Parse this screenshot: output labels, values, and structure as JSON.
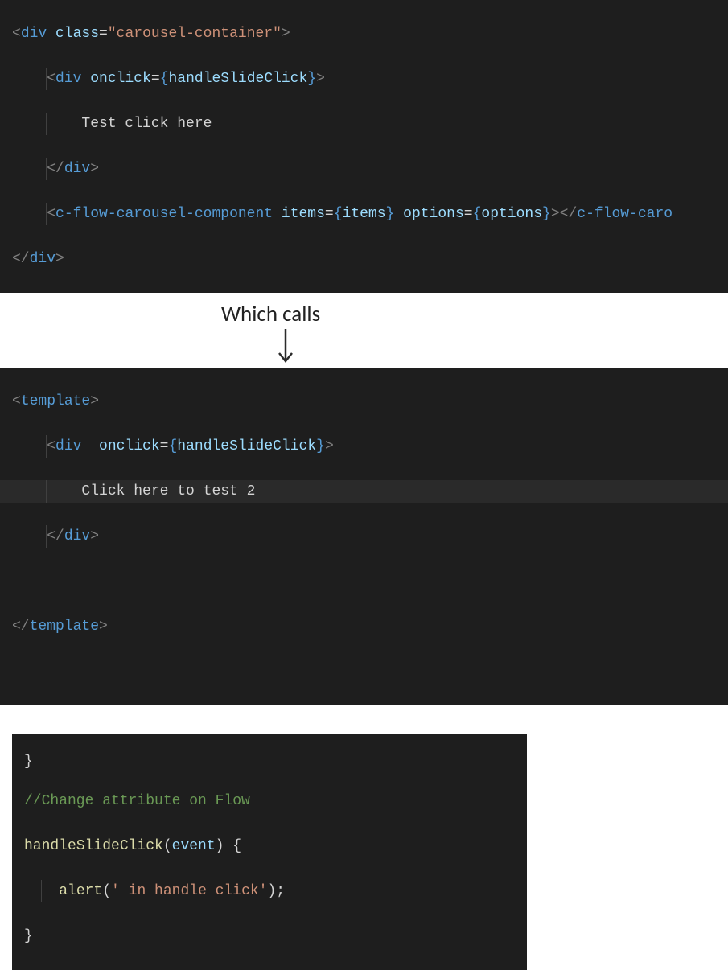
{
  "annotation": {
    "label": "Which calls"
  },
  "code1": {
    "l1": {
      "tag": "div",
      "attr": "class",
      "val": "\"carousel-container\""
    },
    "l2": {
      "tag": "div",
      "attr": "onclick",
      "expr": "handleSlideClick"
    },
    "l3": {
      "text": "Test click here"
    },
    "l4": {
      "tag": "div"
    },
    "l5": {
      "tag": "c-flow-carousel-component",
      "a1": "items",
      "v1": "items",
      "a2": "options",
      "v2": "options",
      "closeTag": "c-flow-caro"
    },
    "l6": {
      "tag": "div"
    }
  },
  "code2": {
    "l1": {
      "tag": "template"
    },
    "l2": {
      "tag": "div",
      "attr": "onclick",
      "expr": "handleSlideClick"
    },
    "l3": {
      "text": "Click here to test 2"
    },
    "l4": {
      "tag": "div"
    },
    "l5": {
      "tag": "template"
    }
  },
  "code3": {
    "l1": {
      "text": "}"
    },
    "l2": {
      "text": "//Change attribute on Flow"
    },
    "l3": {
      "fn": "handleSlideClick",
      "param": "event",
      "tail": ") {"
    },
    "l4": {
      "fn": "alert",
      "arg": "' in handle click'",
      "tail": ");"
    },
    "l5": {
      "text": "}"
    }
  }
}
